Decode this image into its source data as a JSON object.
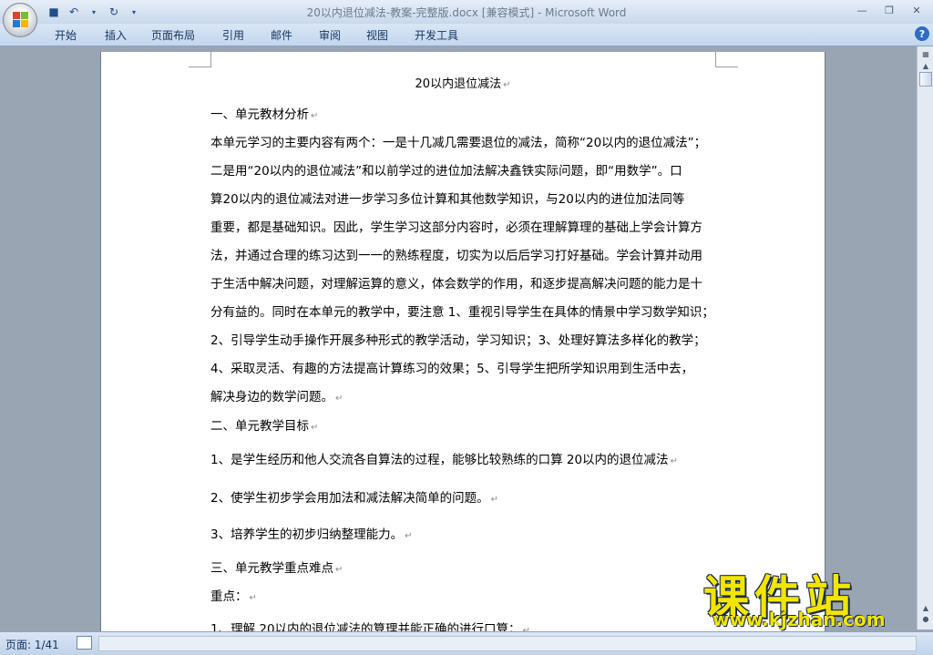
{
  "window": {
    "title": "20以内退位减法-教案-完整版.docx [兼容模式] - Microsoft Word"
  },
  "quick_access": [
    {
      "icon": "save-icon"
    },
    {
      "icon": "undo-icon"
    },
    {
      "icon": "redo-icon"
    }
  ],
  "window_controls": [
    {
      "icon": "minimize-icon"
    },
    {
      "icon": "restore-icon"
    },
    {
      "icon": "close-icon"
    }
  ],
  "ribbon": {
    "tabs": [
      {
        "label": "开始"
      },
      {
        "label": "插入"
      },
      {
        "label": "页面布局"
      },
      {
        "label": "引用"
      },
      {
        "label": "邮件"
      },
      {
        "label": "审阅"
      },
      {
        "label": "视图"
      },
      {
        "label": "开发工具"
      }
    ]
  },
  "document": {
    "title": "20以内退位减法",
    "lines": [
      "一、单元教材分析",
      "本单元学习的主要内容有两个：一是十几减几需要退位的减法，简称“20以内的退位减法”；",
      "二是用“20以内的退位减法”和以前学过的进位加法解决鑫铁实际问题，即“用数学”。口",
      "算20以内的退位减法对进一步学习多位计算和其他数学知识，与20以内的进位加法同等",
      "重要，都是基础知识。因此，学生学习这部分内容时，必须在理解算理的基础上学会计算方",
      "法，并通过合理的练习达到一一的熟练程度，切实为以后后学习打好基础。学会计算并动用",
      "于生活中解决问题，对理解运算的意义，体会数学的作用，和逐步提高解决问题的能力是十",
      "分有益的。同时在本单元的教学中，要注意 1、重视引导学生在具体的情景中学习数学知识；",
      "2、引导学生动手操作开展多种形式的教学活动，学习知识；3、处理好算法多样化的教学；",
      "4、采取灵活、有趣的方法提高计算练习的效果；5、引导学生把所学知识用到生活中去，",
      "解决身边的数学问题。",
      "二、单元教学目标",
      "1、是学生经历和他人交流各自算法的过程，能够比较熟练的口算 20以内的退位减法",
      "2、使学生初步学会用加法和减法解决简单的问题。",
      "3、培养学生的初步归纳整理能力。",
      "三、单元教学重点难点",
      "重点：",
      "1、理解 20以内的退位减法的算理并能正确的进行口算；"
    ]
  },
  "status": {
    "page": "页面: 1/41"
  },
  "watermark": {
    "text": "课件站",
    "url": "www.kjzhan.com"
  }
}
